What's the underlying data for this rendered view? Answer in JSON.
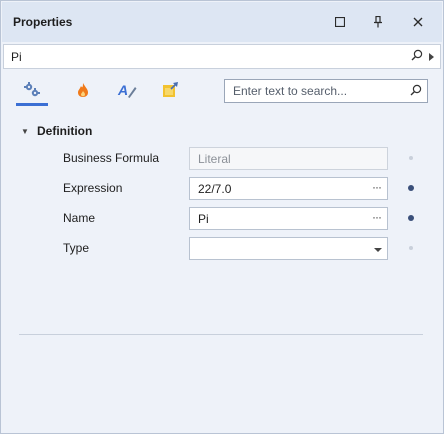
{
  "panel": {
    "title": "Properties",
    "controls": {
      "maximize_icon": "maximize-icon",
      "pin_icon": "pin-icon",
      "close_icon": "close-icon"
    }
  },
  "object_selector": {
    "value": "Pi",
    "icon": "search-icon"
  },
  "toolbar": {
    "tabs": [
      {
        "name": "categorized-icon",
        "active": true
      },
      {
        "name": "events-icon",
        "active": false
      },
      {
        "name": "alphabetical-icon",
        "active": false
      },
      {
        "name": "favorites-icon",
        "active": false
      }
    ],
    "search": {
      "placeholder": "Enter text to search...",
      "value": ""
    }
  },
  "properties": {
    "category": "Definition",
    "rows": [
      {
        "label": "Business Formula",
        "value": "Literal",
        "editor": "readonly",
        "modified": false
      },
      {
        "label": "Expression",
        "value": "22/7.0",
        "editor": "ellipsis",
        "modified": true
      },
      {
        "label": "Name",
        "value": "Pi",
        "editor": "ellipsis",
        "modified": true
      },
      {
        "label": "Type",
        "value": "",
        "editor": "dropdown",
        "modified": false
      }
    ]
  },
  "colors": {
    "accent": "#3b6fd4",
    "panel_bg": "#eef2f9",
    "title_bg": "#dde6f3",
    "modified_dot": "#3a4f7a"
  }
}
